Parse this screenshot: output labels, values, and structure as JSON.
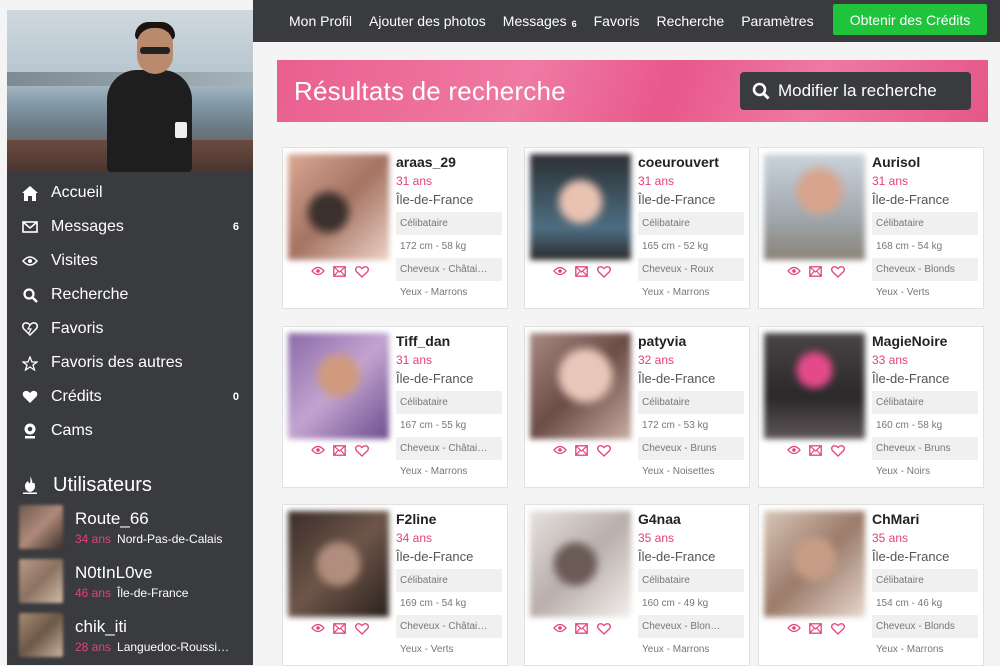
{
  "sidebar": {
    "nav": [
      {
        "label": "Accueil",
        "icon": "home-icon",
        "badge": ""
      },
      {
        "label": "Messages",
        "icon": "envelope-icon",
        "badge": "6"
      },
      {
        "label": "Visites",
        "icon": "eye-icon",
        "badge": ""
      },
      {
        "label": "Recherche",
        "icon": "search-icon",
        "badge": ""
      },
      {
        "label": "Favoris",
        "icon": "heart-outline-icon",
        "badge": ""
      },
      {
        "label": "Favoris des autres",
        "icon": "star-heart-icon",
        "badge": ""
      },
      {
        "label": "Crédits",
        "icon": "heart-icon",
        "badge": "0"
      },
      {
        "label": "Cams",
        "icon": "webcam-icon",
        "badge": ""
      }
    ],
    "users_title": "Utilisateurs",
    "users": [
      {
        "name": "Route_66",
        "age": "34 ans",
        "region": "Nord-Pas-de-Calais"
      },
      {
        "name": "N0tInL0ve",
        "age": "46 ans",
        "region": "Île-de-France"
      },
      {
        "name": "chik_iti",
        "age": "28 ans",
        "region": "Languedoc-Roussi…"
      }
    ]
  },
  "topbar": {
    "links": [
      {
        "label": "Mon Profil",
        "badge": ""
      },
      {
        "label": "Ajouter des photos",
        "badge": ""
      },
      {
        "label": "Messages",
        "badge": "6"
      },
      {
        "label": "Favoris",
        "badge": ""
      },
      {
        "label": "Recherche",
        "badge": ""
      },
      {
        "label": "Paramètres",
        "badge": ""
      }
    ],
    "credits_button": "Obtenir des Crédits"
  },
  "banner": {
    "title": "Résultats de recherche",
    "modify_button": "Modifier la recherche"
  },
  "results": [
    {
      "name": "araas_29",
      "age": "31 ans",
      "region": "Île-de-France",
      "status": "Célibataire",
      "size": "172 cm - 58 kg",
      "hair": "Cheveux - Châtai…",
      "eyes": "Yeux - Marrons"
    },
    {
      "name": "coeurouvert",
      "age": "31 ans",
      "region": "Île-de-France",
      "status": "Célibataire",
      "size": "165 cm - 52 kg",
      "hair": "Cheveux - Roux",
      "eyes": "Yeux - Marrons"
    },
    {
      "name": "Aurisol",
      "age": "31 ans",
      "region": "Île-de-France",
      "status": "Célibataire",
      "size": "168 cm - 54 kg",
      "hair": "Cheveux - Blonds",
      "eyes": "Yeux - Verts"
    },
    {
      "name": "Tiff_dan",
      "age": "31 ans",
      "region": "Île-de-France",
      "status": "Célibataire",
      "size": "167 cm - 55 kg",
      "hair": "Cheveux - Châtai…",
      "eyes": "Yeux - Marrons"
    },
    {
      "name": "patyvia",
      "age": "32 ans",
      "region": "Île-de-France",
      "status": "Célibataire",
      "size": "172 cm - 53 kg",
      "hair": "Cheveux - Bruns",
      "eyes": "Yeux - Noisettes"
    },
    {
      "name": "MagieNoire",
      "age": "33 ans",
      "region": "Île-de-France",
      "status": "Célibataire",
      "size": "160 cm - 58 kg",
      "hair": "Cheveux - Bruns",
      "eyes": "Yeux - Noirs"
    },
    {
      "name": "F2line",
      "age": "34 ans",
      "region": "Île-de-France",
      "status": "Célibataire",
      "size": "169 cm - 54 kg",
      "hair": "Cheveux - Châtai…",
      "eyes": "Yeux - Verts"
    },
    {
      "name": "G4naa",
      "age": "35 ans",
      "region": "Île-de-France",
      "status": "Célibataire",
      "size": "160 cm - 49 kg",
      "hair": "Cheveux - Blon…",
      "eyes": "Yeux - Marrons"
    },
    {
      "name": "ChMari",
      "age": "35 ans",
      "region": "Île-de-France",
      "status": "Célibataire",
      "size": "154 cm - 46 kg",
      "hair": "Cheveux - Blonds",
      "eyes": "Yeux - Marrons"
    }
  ],
  "colors": {
    "accent_pink": "#e4407a",
    "sidebar_bg": "#3a3b3f",
    "credits_green": "#1fc33c"
  }
}
